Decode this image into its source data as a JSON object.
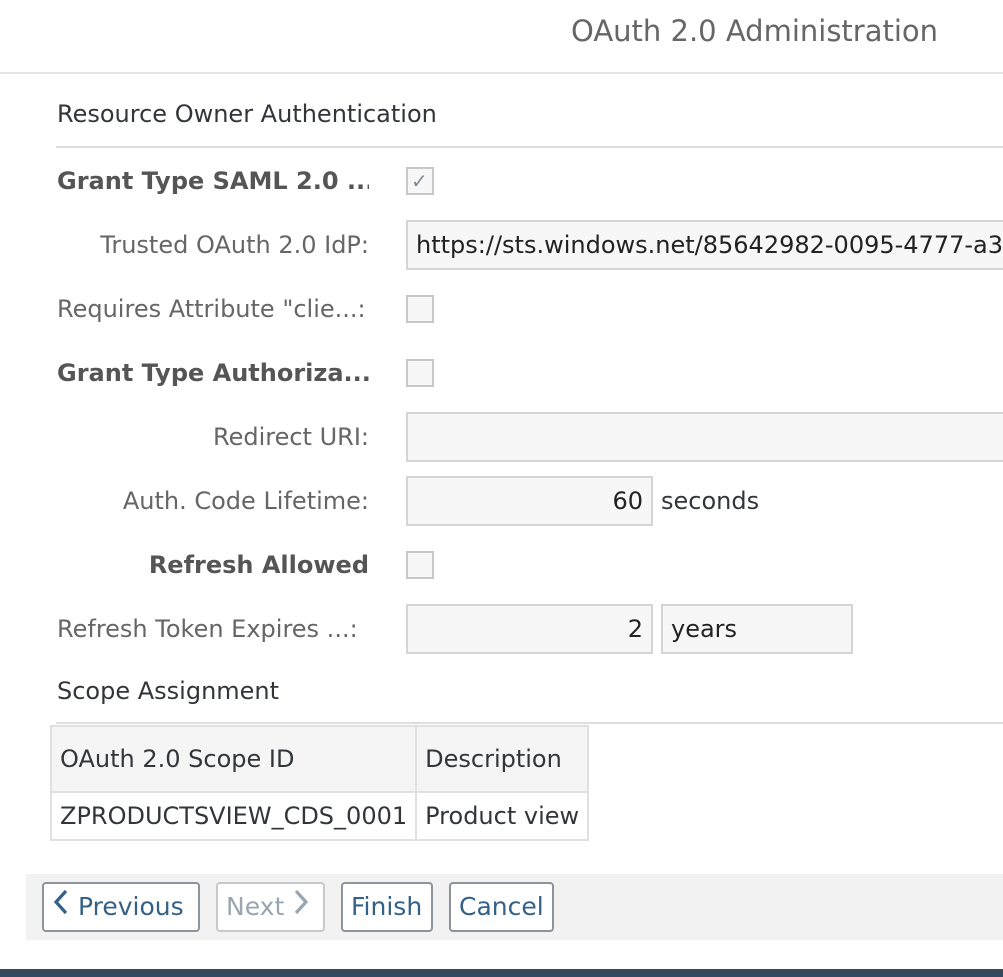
{
  "app": {
    "title": "OAuth 2.0 Administration"
  },
  "section": {
    "title": "Resource Owner Authentication"
  },
  "form": {
    "grant_saml": {
      "label": "Grant Type SAML 2.0 ...",
      "checked": true
    },
    "trusted_idp": {
      "label": "Trusted OAuth 2.0 IdP:",
      "value": "https://sts.windows.net/85642982-0095-4777-a3"
    },
    "requires_attr": {
      "label": "Requires Attribute \"clie...:",
      "checked": false
    },
    "grant_auth": {
      "label": "Grant Type Authoriza...",
      "checked": false
    },
    "redirect_uri": {
      "label": "Redirect URI:",
      "value": ""
    },
    "auth_lifetime": {
      "label": "Auth. Code Lifetime:",
      "value": "60",
      "unit": "seconds"
    },
    "refresh_allowed": {
      "label": "Refresh Allowed",
      "checked": false
    },
    "refresh_expires": {
      "label": "Refresh Token Expires ...:",
      "value": "2",
      "unit": "years"
    }
  },
  "scope": {
    "title": "Scope Assignment",
    "headers": [
      "OAuth 2.0 Scope ID",
      "Description"
    ],
    "rows": [
      [
        "ZPRODUCTSVIEW_CDS_0001",
        "Product view"
      ]
    ]
  },
  "buttons": {
    "previous": "Previous",
    "next": "Next",
    "finish": "Finish",
    "cancel": "Cancel"
  }
}
